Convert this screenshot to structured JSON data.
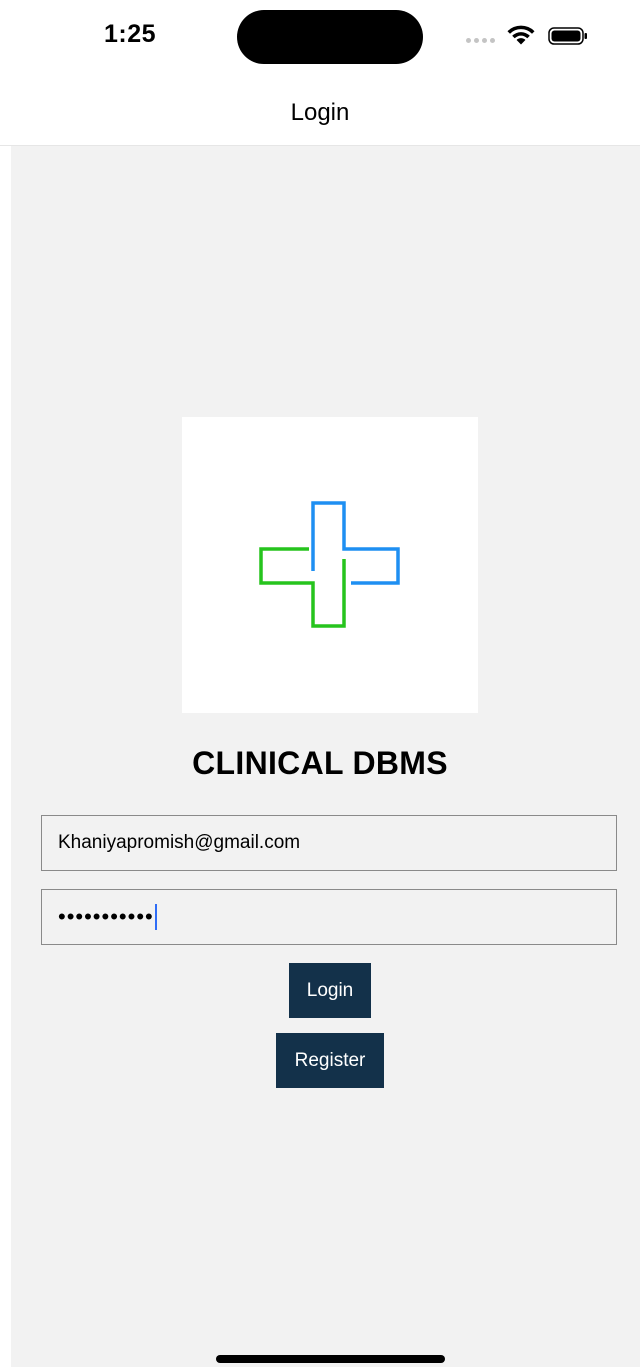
{
  "status_bar": {
    "time": "1:25"
  },
  "nav": {
    "title": "Login"
  },
  "app": {
    "title": "CLINICAL DBMS",
    "logo": "medical-cross-logo",
    "colors": {
      "logo_blue": "#1e8ff2",
      "logo_green": "#26c41d",
      "button_bg": "#13314a",
      "background": "#f2f2f2"
    }
  },
  "form": {
    "email_value": "Khaniyapromish@gmail.com",
    "password_masked": "•••••••••••",
    "login_label": "Login",
    "register_label": "Register"
  }
}
